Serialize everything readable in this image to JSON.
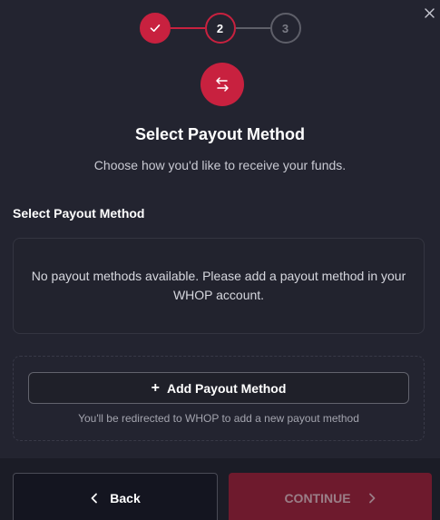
{
  "stepper": {
    "steps": [
      {
        "label": "",
        "state": "done"
      },
      {
        "label": "2",
        "state": "active"
      },
      {
        "label": "3",
        "state": "pending"
      }
    ]
  },
  "header": {
    "icon": "transfer-arrows-icon",
    "title": "Select Payout Method",
    "subtitle": "Choose how you'd like to receive your funds."
  },
  "payout": {
    "section_label": "Select Payout Method",
    "empty_message": "No payout methods available. Please add a payout method in your WHOP account."
  },
  "add_method": {
    "button_label": "Add Payout Method",
    "note": "You'll be redirected to WHOP to add a new payout method"
  },
  "footer": {
    "back_label": "Back",
    "continue_label": "CONTINUE"
  },
  "colors": {
    "accent": "#c8213f",
    "background": "#232430",
    "continue_disabled": "#6e1a2d"
  }
}
